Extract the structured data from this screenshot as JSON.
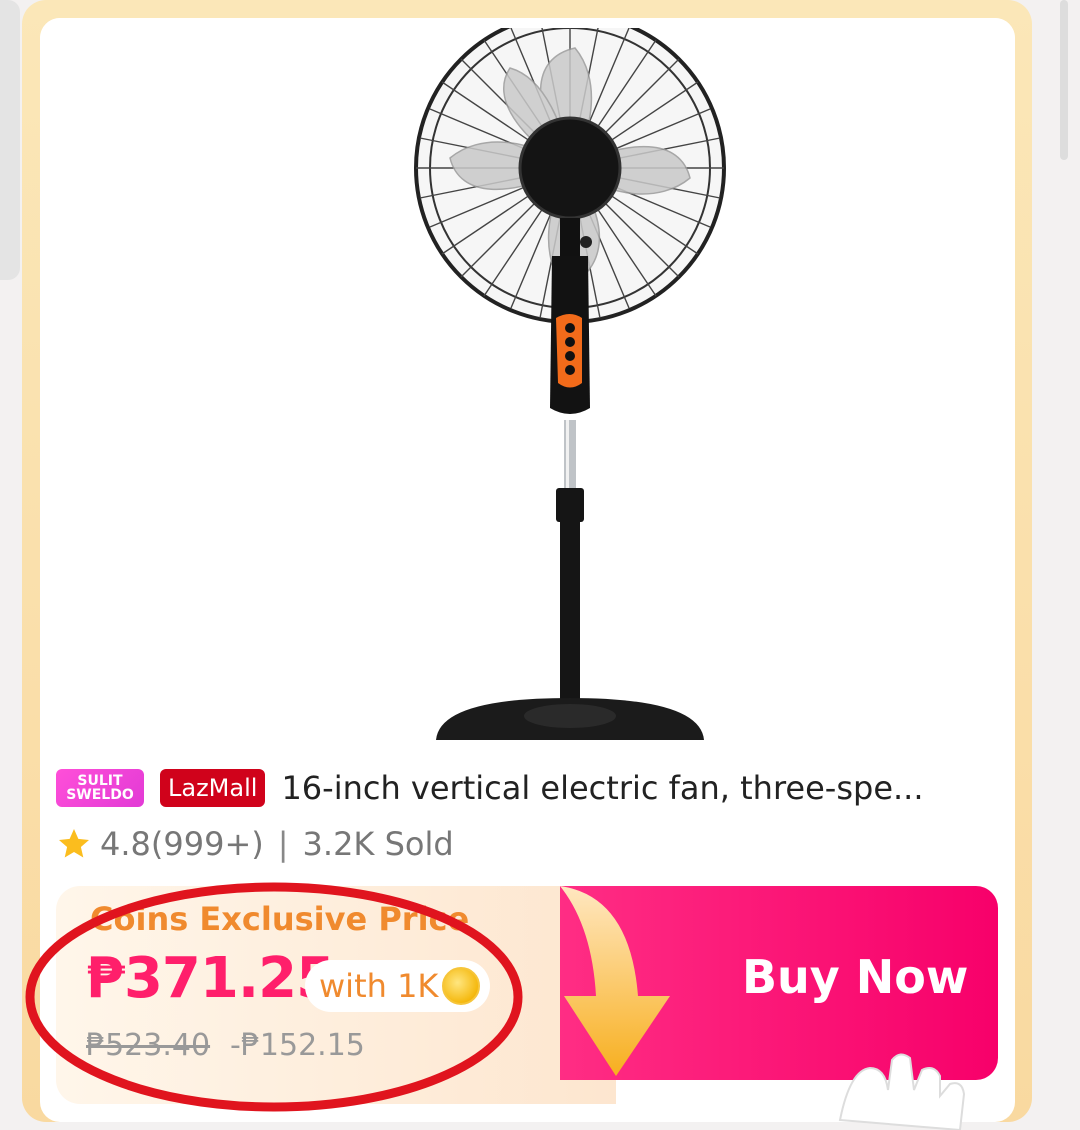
{
  "product": {
    "badge_sulit_line1": "SULIT",
    "badge_sulit_line2": "SWELDO",
    "badge_lazmall": "LazMall",
    "title": "16-inch vertical electric fan, three-spe...",
    "rating": "4.8(999+)",
    "separator": "|",
    "sold": "3.2K Sold"
  },
  "pricing": {
    "coins_label": "Coins Exclusive Price",
    "price": "₱371.25",
    "coin_requirement": "with 1K",
    "original_price": "₱523.40",
    "discount": "-₱152.15"
  },
  "actions": {
    "buy_now": "Buy Now"
  },
  "colors": {
    "price_pink": "#ff1f6b",
    "buy_gradient_start": "#ff2d84",
    "coins_orange": "#f08a2e",
    "lazmall_red": "#d0021b",
    "annotation_red": "#e0141e"
  }
}
